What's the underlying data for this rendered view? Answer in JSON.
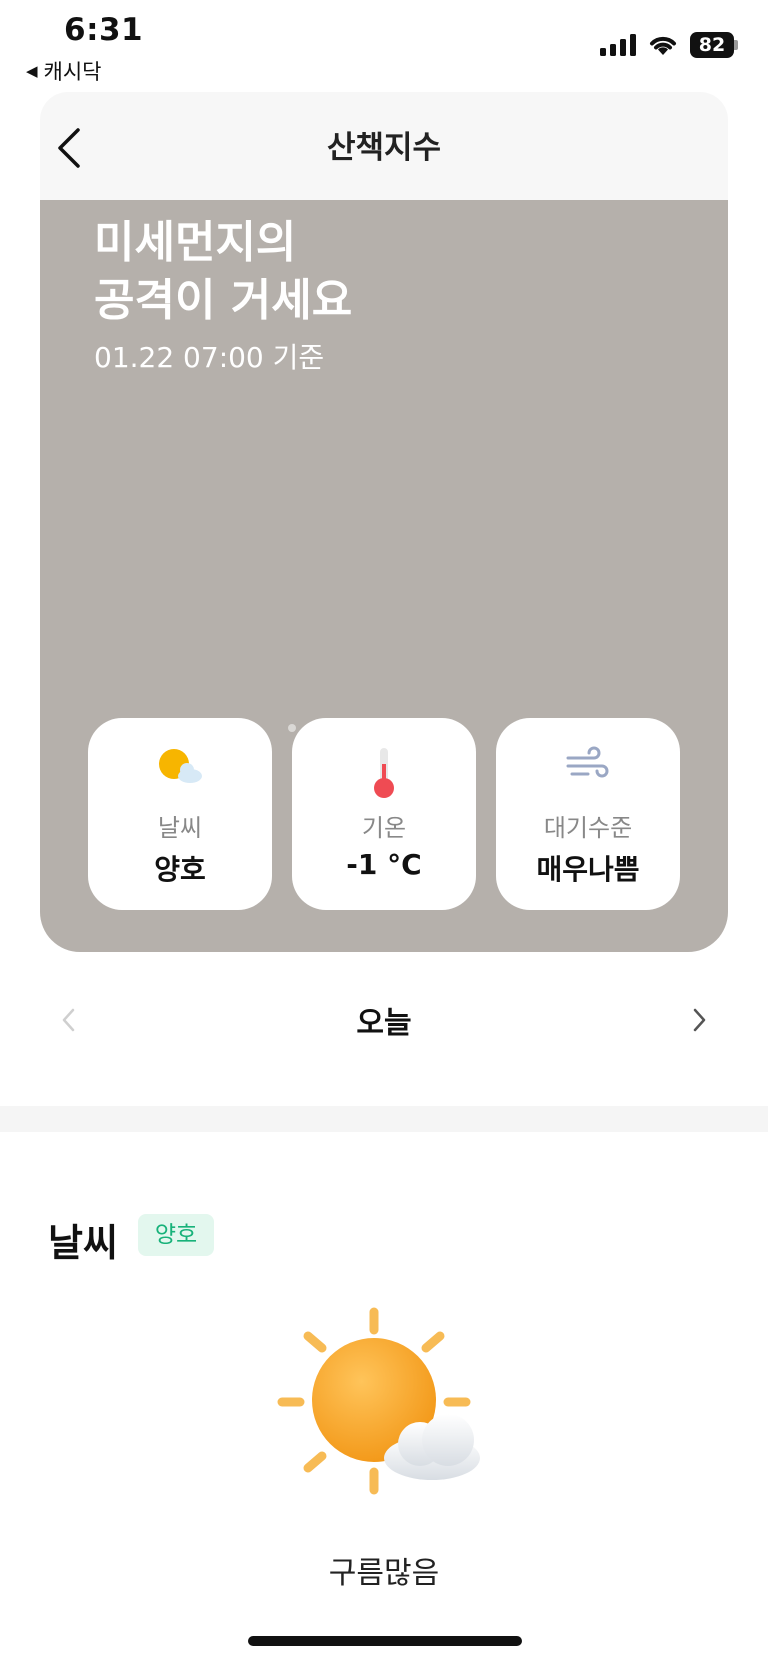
{
  "status_bar": {
    "time": "6:31",
    "back_app": "캐시닥",
    "battery": "82"
  },
  "header": {
    "title": "산책지수"
  },
  "hero": {
    "headline_line1": "미세먼지의",
    "headline_line2": "공격이 거세요",
    "timestamp": "01.22 07:00 기준",
    "background_color": "#b5b0ab"
  },
  "metrics": [
    {
      "icon": "partly-cloudy-icon",
      "label": "날씨",
      "value": "양호"
    },
    {
      "icon": "thermometer-icon",
      "label": "기온",
      "value": "-1 °C"
    },
    {
      "icon": "wind-icon",
      "label": "대기수준",
      "value": "매우나쁨"
    }
  ],
  "day_pager": {
    "label": "오늘"
  },
  "weather_section": {
    "title": "날씨",
    "badge": "양호",
    "badge_color": "#18b27a",
    "icon": "sun-cloud-icon",
    "description": "구름많음"
  }
}
